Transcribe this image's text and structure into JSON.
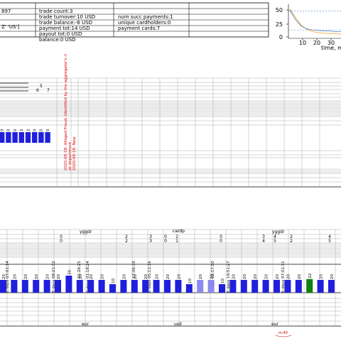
{
  "stats_table": {
    "col1": [
      "897",
      "",
      "Z' 'US']",
      ""
    ],
    "col2": [
      "trade count:3",
      "trade turnover:10 USD",
      "trade balance:-6 USD",
      "payment tot:14 USD",
      "payout tot:0 USD",
      "balance:0 USD"
    ],
    "col3": [
      "",
      "num succ payments:1",
      "unique cardholders:0",
      "payment cards:7"
    ]
  },
  "mini_chart": {
    "chart_data": {
      "type": "line",
      "xlabel": "time, mi",
      "x_ticks": [
        "10",
        "20",
        "30"
      ],
      "y_ticks": [
        "50",
        "25",
        "0"
      ],
      "series": [
        {
          "color": "#f5a623",
          "values": [
            52,
            36,
            22,
            14,
            10,
            8,
            7,
            6,
            6,
            5
          ]
        },
        {
          "color": "#4a7fc1",
          "values": [
            50,
            32,
            20,
            15,
            13,
            12,
            11,
            11,
            10,
            10
          ]
        }
      ],
      "ref_lines": [
        48,
        13
      ]
    }
  },
  "upper_panel": {
    "count_labels": [
      "5",
      "6",
      "7"
    ],
    "bar_labels": [
      "0",
      "0",
      "0",
      "2",
      "2",
      "0",
      "0",
      "0"
    ],
    "annotations": [
      "2020-08-18: Alleged Fraud, Identified by the aggregator's ri",
      "sk department",
      "2020-08-18: New"
    ],
    "annotation_color": "#e00000",
    "bar_color": "#1f1fdc"
  },
  "lower_panel": {
    "group_labels": [
      "yggdr",
      "cardp",
      "yggdr"
    ],
    "row_top": [
      "0",
      "2",
      "3",
      "0",
      "1",
      "0",
      "3",
      "4",
      "2",
      "4"
    ],
    "row_bottom": [
      "0",
      "2",
      "3",
      "0",
      "1",
      "0",
      "4",
      "5",
      "2",
      "5"
    ],
    "duration_labels": [
      "0 days 07:01:14",
      "0 days 08:21:32",
      "1 days 01:26:25",
      "0 days 01:18:24",
      "0 days 17:06:39",
      "0 days 05:11:16",
      "0 days 02:57:50",
      "0 days 19:51:27",
      "0 days 07:01:31"
    ],
    "bar_value_labels": [
      "20",
      "20",
      "20",
      "20",
      "20",
      "20",
      "30",
      "20",
      "20",
      "20",
      "10",
      "20",
      "20",
      "20",
      "20",
      "20",
      "20",
      "10",
      "20",
      "20",
      "10",
      "20",
      "20",
      "20",
      "20",
      "20",
      "20",
      "20",
      "22",
      "20",
      "20"
    ],
    "currency_labels": [
      "eur",
      "usd",
      "eur"
    ],
    "footer_note": "m:40",
    "bar_colors": {
      "normal": "#1f1fdc",
      "light": "#8a8af0",
      "highlight": "#108010"
    }
  }
}
